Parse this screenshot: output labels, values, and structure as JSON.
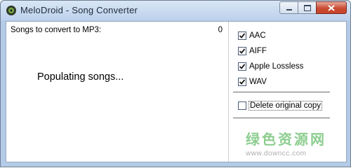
{
  "window": {
    "title": "MeloDroid - Song Converter"
  },
  "header": {
    "songs_label": "Songs to convert to MP3:",
    "songs_count": "0"
  },
  "main": {
    "status": "Populating songs..."
  },
  "formats": [
    {
      "label": "AAC",
      "checked": true
    },
    {
      "label": "AIFF",
      "checked": true
    },
    {
      "label": "Apple Lossless",
      "checked": true
    },
    {
      "label": "WAV",
      "checked": true
    }
  ],
  "options": {
    "delete_original": {
      "label": "Delete original copy",
      "checked": false
    }
  },
  "watermark": {
    "text_cn": "绿色资源网",
    "url": "www.downcc.com"
  },
  "colors": {
    "title_bar": "#c5d7ee",
    "close_button": "#c94b33",
    "watermark": "#2fa535"
  }
}
